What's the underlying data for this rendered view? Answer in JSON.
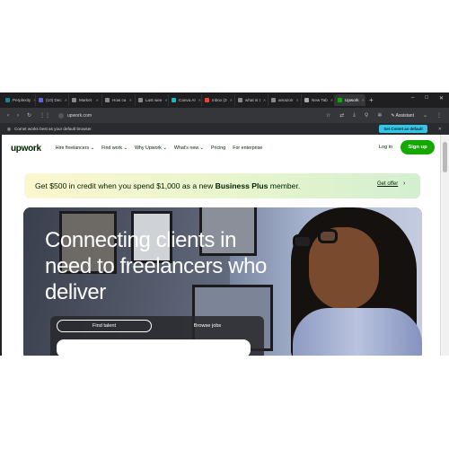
{
  "browser": {
    "tabs": [
      {
        "label": "Perplexity",
        "color": "#20808d"
      },
      {
        "label": "(10) Dec",
        "color": "#5865f2"
      },
      {
        "label": "Market",
        "color": "#888888"
      },
      {
        "label": "How ca",
        "color": "#888888"
      },
      {
        "label": "Last wee",
        "color": "#888888"
      },
      {
        "label": "Canva AI",
        "color": "#00c4cc"
      },
      {
        "label": "Inbox (3",
        "color": "#ea4335"
      },
      {
        "label": "what is t",
        "color": "#888888"
      },
      {
        "label": "amazon",
        "color": "#888888"
      },
      {
        "label": "New Tab",
        "color": "#aaaaaa"
      }
    ],
    "active_tab": {
      "label": "Upwork",
      "color": "#14a800"
    },
    "new_tab_symbol": "+",
    "window_controls": [
      "–",
      "□",
      "✕"
    ],
    "url": "upwork.com",
    "assistant_label": "Assistant",
    "comet_message": "Comet works best as your default browser",
    "comet_button": "Set Comet as default",
    "comet_close": "✕"
  },
  "nav": {
    "logo": "upwork",
    "items": [
      "Hire freelancers ⌄",
      "Find work ⌄",
      "Why Upwork ⌄",
      "What's new ⌄",
      "Pricing",
      "For enterprise"
    ],
    "login": "Log in",
    "signup": "Sign up"
  },
  "promo": {
    "text_before": "Get $500 in credit when you spend $1,000 as a new ",
    "text_bold": "Business Plus",
    "text_after": " member.",
    "link": "Get offer",
    "chevron": "›"
  },
  "hero": {
    "headline": "Connecting clients in need to freelancers who deliver",
    "tab_active": "Find talent",
    "tab_other": "Browse jobs"
  },
  "colors": {
    "brand_green": "#14a800",
    "comet_accent": "#33c6e8"
  }
}
